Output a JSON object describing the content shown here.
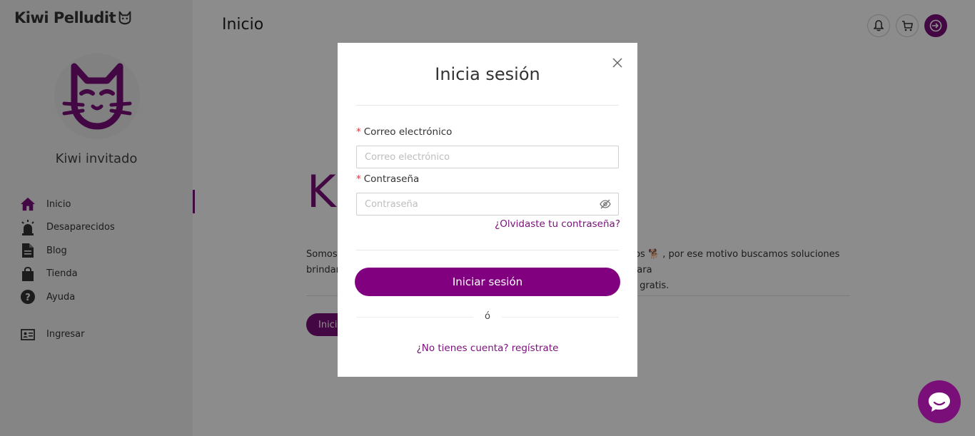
{
  "app": {
    "logo_text": "Kiwi Pelludit",
    "logo_icon": "cat-face-icon"
  },
  "sidebar": {
    "username": "Kiwi invitado",
    "items": [
      {
        "label": "Inicio",
        "icon": "home-icon",
        "active": true
      },
      {
        "label": "Desaparecidos",
        "icon": "alarm-light-icon"
      },
      {
        "label": "Blog",
        "icon": "document-icon"
      },
      {
        "label": "Tienda",
        "icon": "shopping-bag-icon"
      },
      {
        "label": "Ayuda",
        "icon": "help-circle-icon"
      }
    ],
    "login_item": {
      "label": "Ingresar",
      "icon": "id-card-icon"
    }
  },
  "header": {
    "title": "Inicio",
    "buttons": [
      "bell-icon",
      "cart-icon",
      "login-icon"
    ]
  },
  "background": {
    "hero_letter": "K",
    "text_left": "Somos c",
    "text_left_2": "brindar",
    "text_right": "tos 🐕 , por ese motivo buscamos soluciones para",
    "text_right_2": "e gratis.",
    "button_label": "Inicia"
  },
  "modal": {
    "title": "Inicia sesión",
    "email_label": "Correo electrónico",
    "email_placeholder": "Correo electrónico",
    "password_label": "Contraseña",
    "password_placeholder": "Contraseña",
    "forgot_link": "¿Olvidaste tu contraseña?",
    "submit_label": "Iniciar sesión",
    "or_text": "ó",
    "register_link": "¿No tienes cuenta? regístrate",
    "required_mark": "*"
  },
  "colors": {
    "accent": "#800080",
    "overlay": "rgba(0,0,0,0.45)"
  }
}
